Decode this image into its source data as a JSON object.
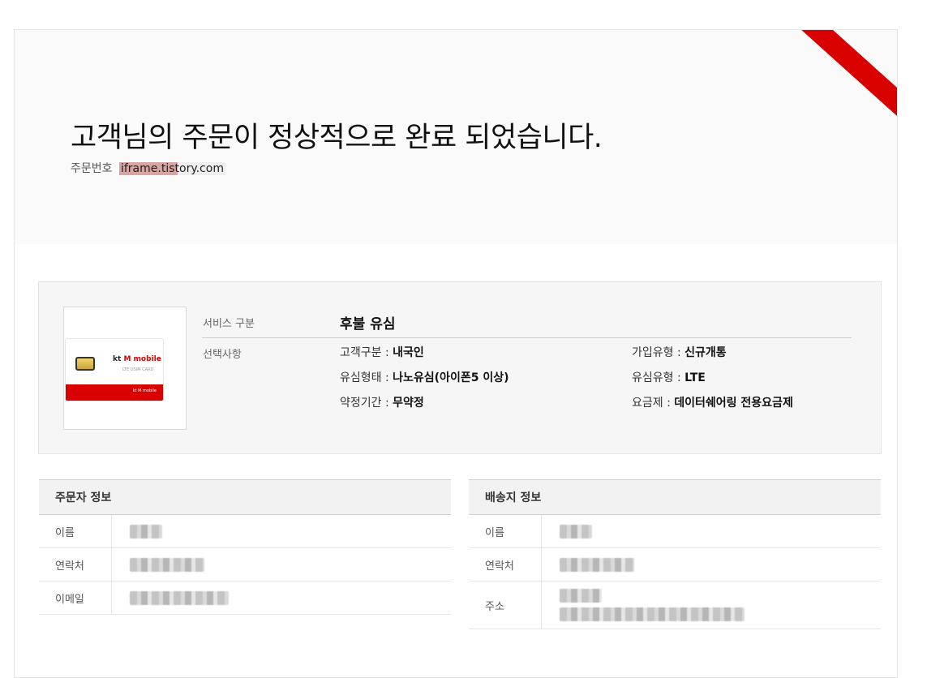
{
  "header": {
    "title": "고객님의 주문이 정상적으로 완료 되었습니다.",
    "order_label": "주문번호",
    "order_value": "iframe.tistory.com"
  },
  "product": {
    "image_icon": "sim-card-icon",
    "sim_card": {
      "brand_kt": "kt",
      "brand_mobile": "M mobile",
      "subtitle": "LTE USIM CARD",
      "footer_logo": "kt M mobile"
    },
    "service_label": "서비스 구분",
    "service_value": "후불 유심",
    "options_label": "선택사항",
    "options": [
      {
        "label": "고객구분 : ",
        "value": "내국인"
      },
      {
        "label": "가입유형 : ",
        "value": "신규개통"
      },
      {
        "label": "유심형태 : ",
        "value": "나노유심(아이폰5 이상)"
      },
      {
        "label": "유심유형 : ",
        "value": "LTE"
      },
      {
        "label": "약정기간 : ",
        "value": "무약정"
      },
      {
        "label": "요금제 : ",
        "value": "데이터쉐어링 전용요금제"
      }
    ]
  },
  "orderer": {
    "title": "주문자 정보",
    "rows": [
      {
        "label": "이름"
      },
      {
        "label": "연락처"
      },
      {
        "label": "이메일"
      }
    ]
  },
  "shipping": {
    "title": "배송지 정보",
    "rows": [
      {
        "label": "이름"
      },
      {
        "label": "연락처"
      },
      {
        "label": "주소"
      }
    ]
  },
  "colors": {
    "accent": "#d90000",
    "panel_bg": "#f6f6f6",
    "header_bg": "#f2f2f2"
  }
}
